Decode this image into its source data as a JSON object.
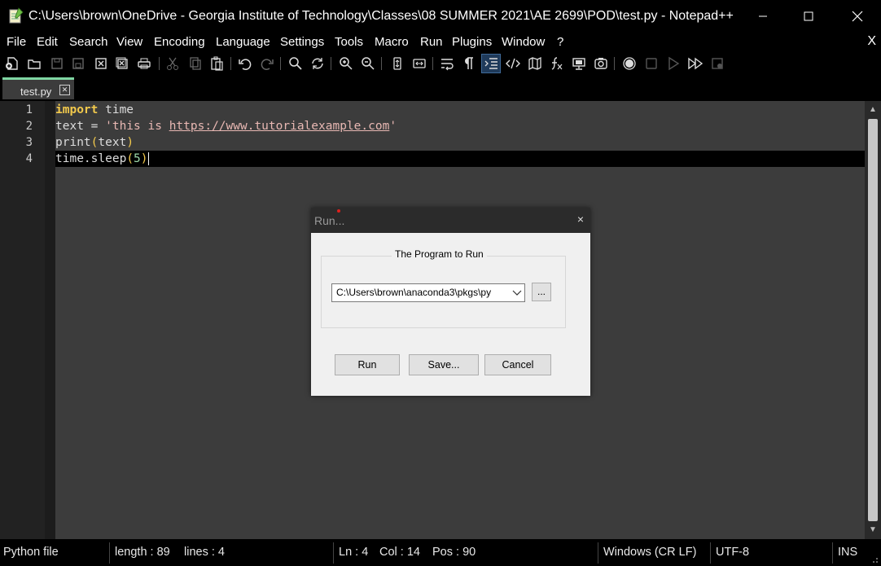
{
  "window": {
    "title": "C:\\Users\\brown\\OneDrive - Georgia Institute of Technology\\Classes\\08 SUMMER 2021\\AE 2699\\POD\\test.py - Notepad++"
  },
  "menu": {
    "items": [
      "File",
      "Edit",
      "Search",
      "View",
      "Encoding",
      "Language",
      "Settings",
      "Tools",
      "Macro",
      "Run",
      "Plugins",
      "Window",
      "?"
    ],
    "close_label": "X"
  },
  "toolbar": {
    "icons": [
      "new-file-icon",
      "open-file-icon",
      "save-icon",
      "save-all-icon",
      "close-icon",
      "close-all-icon",
      "print-icon",
      "cut-icon",
      "copy-icon",
      "paste-icon",
      "undo-icon",
      "redo-icon",
      "find-icon",
      "replace-icon",
      "zoom-in-icon",
      "zoom-out-icon",
      "sync-vertical-icon",
      "sync-horizontal-icon",
      "word-wrap-icon",
      "show-all-characters-icon",
      "indent-guide-icon",
      "xml-tag-icon",
      "document-map-icon",
      "function-list-icon",
      "monitor-icon",
      "folder-workspace-icon",
      "record-macro-icon",
      "stop-macro-icon",
      "play-macro-icon",
      "run-macro-multiple-icon",
      "save-macro-icon"
    ]
  },
  "tabs": [
    {
      "label": "test.py",
      "close": "✕"
    }
  ],
  "editor": {
    "line_numbers": [
      "1",
      "2",
      "3",
      "4"
    ],
    "code": {
      "l1_kw": "import",
      "l1_rest": " time",
      "l2_a": "text = ",
      "l2_str": "'this is ",
      "l2_url": "https://www.tutorialexample.com",
      "l2_end": "'",
      "l3_a": "print",
      "l3_open": "(",
      "l3_b": "text",
      "l3_close": ")",
      "l4_a": "time.sleep",
      "l4_open": "(",
      "l4_num": "5",
      "l4_close": ")"
    }
  },
  "dialog": {
    "title": "Run...",
    "close": "×",
    "group_label": "The Program to Run",
    "program_value": "C:\\Users\\brown\\anaconda3\\pkgs\\py",
    "browse_label": "...",
    "run_label": "Run",
    "save_label": "Save...",
    "cancel_label": "Cancel"
  },
  "status": {
    "file_type": "Python file",
    "length": "length : 89",
    "lines": "lines : 4",
    "ln": "Ln : 4",
    "col": "Col : 14",
    "pos": "Pos : 90",
    "eol": "Windows (CR LF)",
    "encoding": "UTF-8",
    "mode": "INS"
  },
  "colors": {
    "keyword": "#f2c94c",
    "string": "#e8b8b3",
    "number": "#9cd7a8",
    "tab_accent": "#7fd6a3"
  }
}
